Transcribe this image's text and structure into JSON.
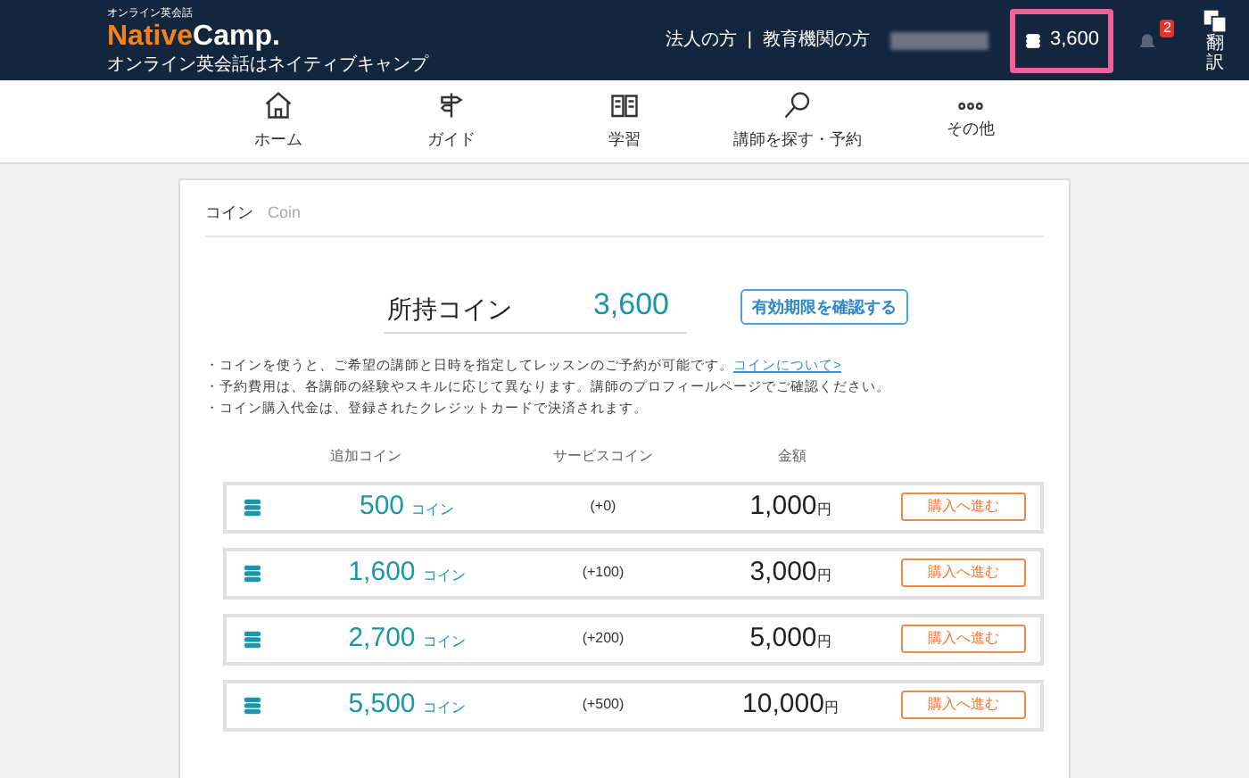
{
  "header": {
    "logo_tagline": "オンライン英会話",
    "logo": {
      "part1": "Native",
      "part2": "Camp."
    },
    "subtitle": "オンライン英会話はネイティブキャンプ",
    "links": [
      "法人の方",
      "|",
      "教育機関の方"
    ],
    "coins": "3,600",
    "highlighted": true,
    "notifications": "2",
    "translate": "翻訳"
  },
  "nav": [
    {
      "label": "ホーム",
      "kind": "home"
    },
    {
      "label": "ガイド",
      "kind": "sign"
    },
    {
      "label": "学習",
      "kind": "book"
    },
    {
      "label": "講師を探す・予約",
      "kind": "search"
    },
    {
      "label": "その他",
      "kind": "more"
    }
  ],
  "card": {
    "title": "コイン",
    "subtitle": "Coin",
    "balance_label": "所持コイン",
    "balance": "3,600",
    "expiry_button": "有効期限を確認する",
    "notes": [
      {
        "text": "・コインを使うと、ご希望の講師と日時を指定してレッスンのご予約が可能です。",
        "link": "コインについて>"
      },
      {
        "text": "・予約費用は、各講師の経験やスキルに応じて異なります。講師のプロフィールページでご確認ください。"
      },
      {
        "text": "・コイン購入代金は、登録されたクレジットカードで決済されます。"
      }
    ],
    "columns": [
      "追加コイン",
      "サービスコイン",
      "金額"
    ],
    "rows": [
      {
        "coins": "500",
        "unit": "コイン",
        "bonus": "(+0)",
        "price": "1,000",
        "currency": "円",
        "button": "購入へ進む"
      },
      {
        "coins": "1,600",
        "unit": "コイン",
        "bonus": "(+100)",
        "price": "3,000",
        "currency": "円",
        "button": "購入へ進む"
      },
      {
        "coins": "2,700",
        "unit": "コイン",
        "bonus": "(+200)",
        "price": "5,000",
        "currency": "円",
        "button": "購入へ進む"
      },
      {
        "coins": "5,500",
        "unit": "コイン",
        "bonus": "(+500)",
        "price": "10,000",
        "currency": "円",
        "button": "購入へ進む"
      }
    ]
  }
}
